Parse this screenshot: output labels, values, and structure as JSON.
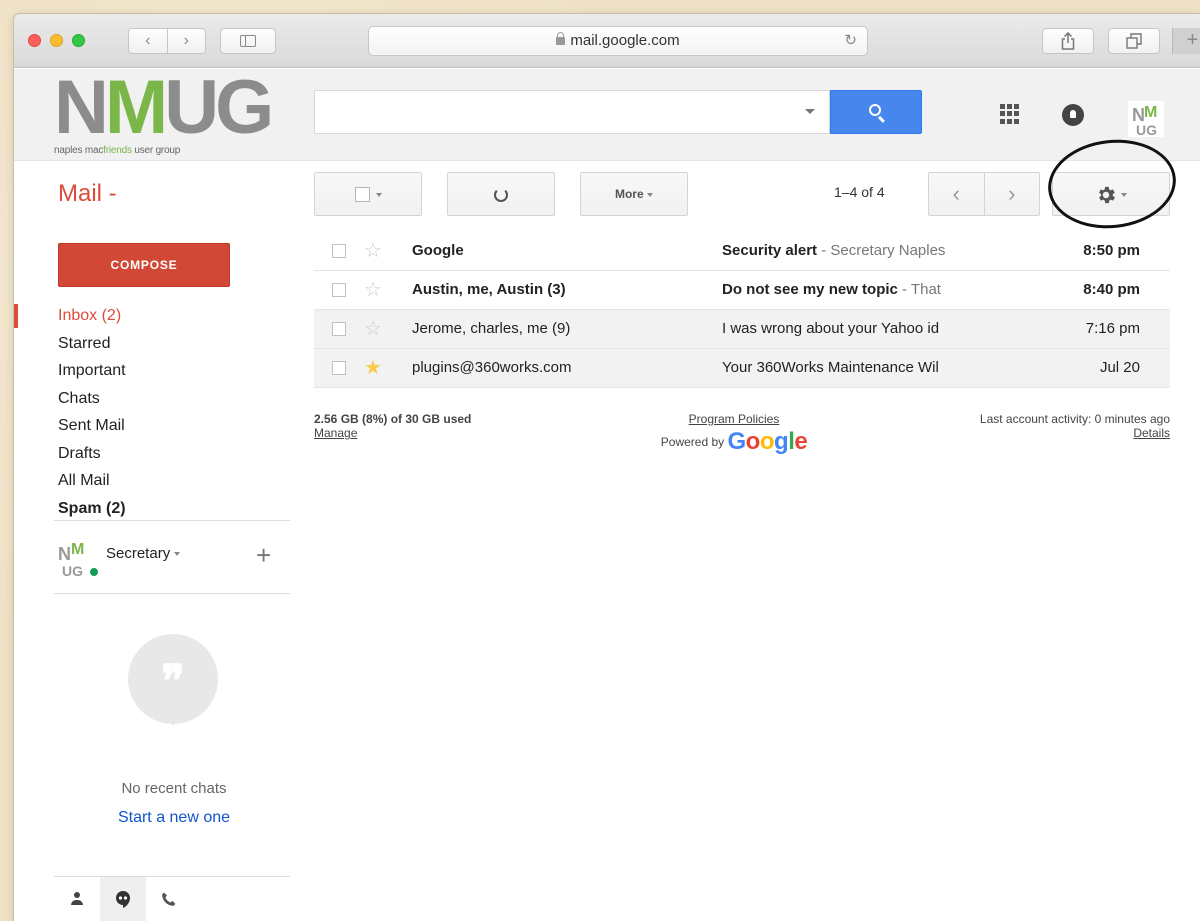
{
  "browser": {
    "url": "mail.google.com",
    "nav_back": "‹",
    "nav_forward": "›"
  },
  "brand": {
    "logo_text_1": "N",
    "logo_text_2": "M",
    "logo_text_3": "UG",
    "tagline_1": "naples mac",
    "tagline_2": "friends",
    "tagline_3": " user group"
  },
  "toolbar": {
    "mail_label": "Mail -",
    "more_label": "More",
    "pagination": "1–4 of 4",
    "prev": "‹",
    "next": "›"
  },
  "nav": {
    "compose_label": "COMPOSE",
    "items": [
      {
        "label": "Inbox (2)"
      },
      {
        "label": "Starred"
      },
      {
        "label": "Important"
      },
      {
        "label": "Chats"
      },
      {
        "label": "Sent Mail"
      },
      {
        "label": "Drafts"
      },
      {
        "label": "All Mail"
      },
      {
        "label": "Spam (2)"
      }
    ]
  },
  "hangouts": {
    "user_name": "Secretary",
    "add": "+",
    "no_chats": "No recent chats",
    "start_new": "Start a new one"
  },
  "emails": [
    {
      "from": "Google",
      "subject": "Security alert",
      "snippet": " - Secretary Naples",
      "date": "8:50 pm",
      "starred": false,
      "unread": true
    },
    {
      "from": "Austin, me, Austin (3)",
      "subject": "Do not see my new topic",
      "snippet": " - That",
      "date": "8:40 pm",
      "starred": false,
      "unread": true
    },
    {
      "from": "Jerome, charles, me (9)",
      "subject": "I was wrong about your Yahoo id",
      "snippet": "",
      "date": "7:16 pm",
      "starred": false,
      "unread": false
    },
    {
      "from": "plugins@360works.com",
      "subject": "Your 360Works Maintenance Wil",
      "snippet": "",
      "date": "Jul 20",
      "starred": true,
      "unread": false
    }
  ],
  "footer": {
    "storage": "2.56 GB (8%) of 30 GB used",
    "manage": "Manage",
    "policies": "Program Policies",
    "powered_by": "Powered by",
    "google_letters": [
      "G",
      "o",
      "o",
      "g",
      "l",
      "e"
    ],
    "activity": "Last account activity: 0 minutes ago",
    "details": "Details"
  },
  "colors": {
    "accent_red": "#dd4b39",
    "compose_red": "#d14836",
    "search_blue": "#4787ed",
    "star_gold": "#f7cb4d",
    "brand_green": "#7ab648"
  },
  "icons": [
    "lock-icon",
    "reload-icon",
    "share-icon",
    "tabs-icon",
    "search-icon",
    "apps-grid-icon",
    "notifications-icon",
    "refresh-icon",
    "gear-icon",
    "star-icon",
    "person-icon",
    "chat-icon",
    "phone-icon"
  ]
}
